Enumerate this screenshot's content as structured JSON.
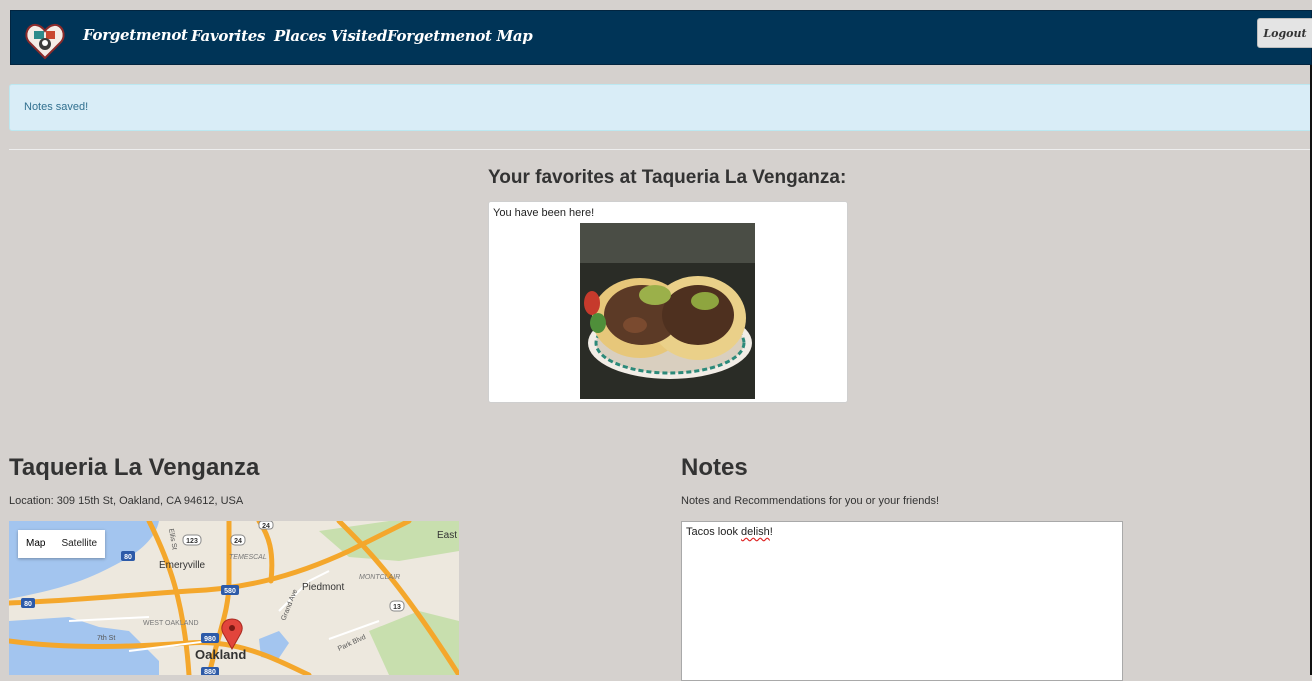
{
  "nav": {
    "brand": "Forgetmenot",
    "links": [
      "Favorites",
      "Places Visited",
      "Forgetmenot Map"
    ],
    "logout": "Logout"
  },
  "alert": {
    "text": "Notes saved!"
  },
  "favorites": {
    "heading": "Your favorites at Taqueria La Venganza:",
    "card_text": "You have been here!"
  },
  "place": {
    "name": "Taqueria La Venganza",
    "location": "Location: 309 15th St, Oakland, CA 94612, USA"
  },
  "map": {
    "type_options": [
      "Map",
      "Satellite"
    ],
    "selected_type": "Map",
    "labels": {
      "emeryville": "Emeryville",
      "piedmont": "Piedmont",
      "oakland": "Oakland",
      "east": "East",
      "temescal": "TEMESCAL",
      "montclair": "MONTCLAIR",
      "west_oakland": "WEST OAKLAND",
      "grand_ave": "Grand Ave",
      "park_blvd": "Park Blvd",
      "seventh_st": "7th St",
      "r80a": "80",
      "r80b": "80",
      "r123": "123",
      "r24a": "24",
      "r24b": "24",
      "r580": "580",
      "r980": "980",
      "r880": "880",
      "r13": "13",
      "ellis": "Ellis St"
    },
    "colors": {
      "highway": "#f4a72c",
      "land": "#ede8de",
      "water": "#a3c5ef",
      "park": "#c8dfae",
      "pin": "#e2453c"
    }
  },
  "notes": {
    "title": "Notes",
    "subtitle": "Notes and Recommendations for you or your friends!",
    "value_before": "Tacos look ",
    "value_misspelled": "delish",
    "value_after": "!"
  },
  "colors": {
    "navbar": "#003457",
    "page_bg": "#d5d1ce",
    "alert_bg": "#d9edf7",
    "alert_text": "#31708f"
  }
}
